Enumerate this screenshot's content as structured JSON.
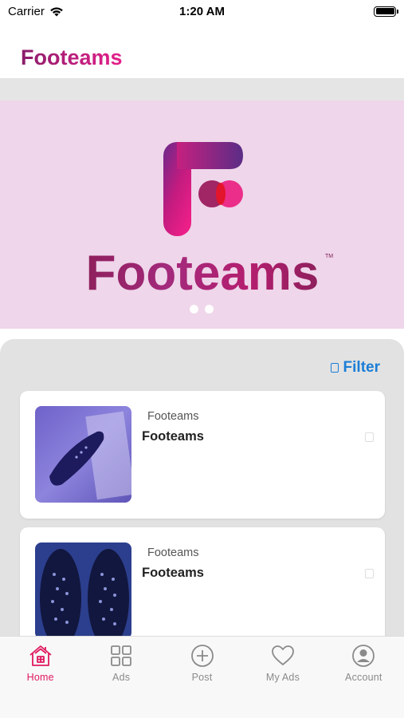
{
  "status_bar": {
    "carrier": "Carrier",
    "time": "1:20 AM"
  },
  "header": {
    "brand": "Footeams",
    "brand_gradient": [
      "#8a1d6a",
      "#e6208b"
    ]
  },
  "banner": {
    "background_color": "#efd6ea",
    "wordmark": "Footeams",
    "trademark": "TM",
    "slide_count": 2,
    "active_slide": 1,
    "logo_colors": [
      "#5d2a86",
      "#e61f88",
      "#b8157a"
    ]
  },
  "listing": {
    "filter_label": "Filter",
    "accent_color": "#1b7ed6",
    "items": [
      {
        "category": "Footeams",
        "title": "Footeams",
        "image": "shoe-insole-photo"
      },
      {
        "category": "Footeams",
        "title": "Footeams",
        "image": "dotted-insoles-photo"
      }
    ]
  },
  "tab_bar": {
    "active_color": "#e0185f",
    "tabs": [
      {
        "label": "Home",
        "icon": "home-icon",
        "active": true
      },
      {
        "label": "Ads",
        "icon": "grid-icon",
        "active": false
      },
      {
        "label": "Post",
        "icon": "plus-circle-icon",
        "active": false
      },
      {
        "label": "My Ads",
        "icon": "heart-icon",
        "active": false
      },
      {
        "label": "Account",
        "icon": "user-circle-icon",
        "active": false
      }
    ]
  }
}
